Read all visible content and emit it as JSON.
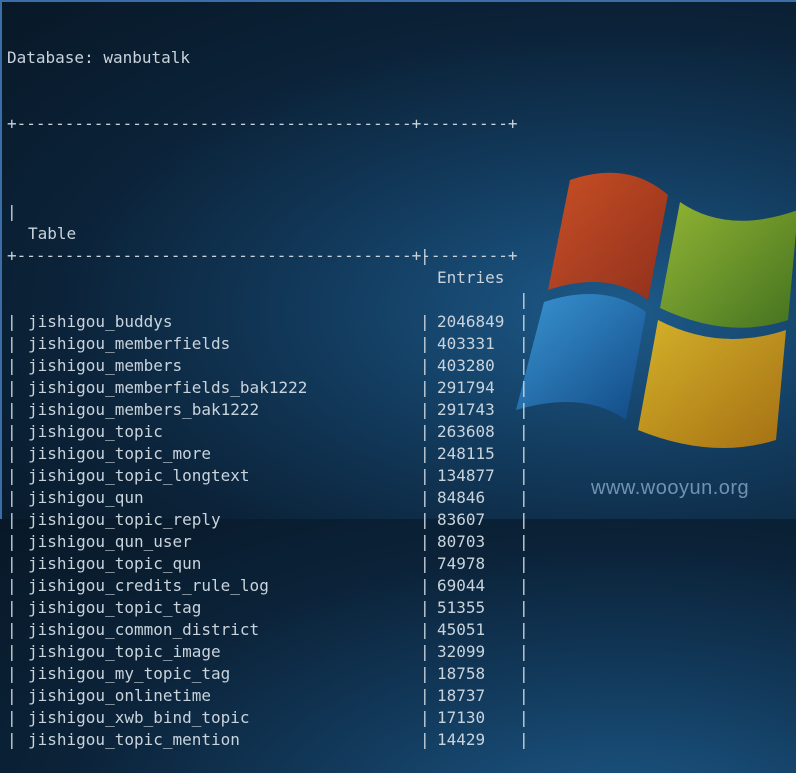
{
  "header": {
    "database_line": "Database: wanbutalk"
  },
  "table": {
    "rule": "+-----------------------------------------+---------+",
    "col_table": "Table",
    "col_entries": "Entries",
    "rows": [
      {
        "name": "jishigou_buddys",
        "entries": "2046849"
      },
      {
        "name": "jishigou_memberfields",
        "entries": "403331"
      },
      {
        "name": "jishigou_members",
        "entries": "403280"
      },
      {
        "name": "jishigou_memberfields_bak1222",
        "entries": "291794"
      },
      {
        "name": "jishigou_members_bak1222",
        "entries": "291743"
      },
      {
        "name": "jishigou_topic",
        "entries": "263608"
      },
      {
        "name": "jishigou_topic_more",
        "entries": "248115"
      },
      {
        "name": "jishigou_topic_longtext",
        "entries": "134877"
      },
      {
        "name": "jishigou_qun",
        "entries": "84846"
      },
      {
        "name": "jishigou_topic_reply",
        "entries": "83607"
      },
      {
        "name": "jishigou_qun_user",
        "entries": "80703"
      },
      {
        "name": "jishigou_topic_qun",
        "entries": "74978"
      },
      {
        "name": "jishigou_credits_rule_log",
        "entries": "69044"
      },
      {
        "name": "jishigou_topic_tag",
        "entries": "51355"
      },
      {
        "name": "jishigou_common_district",
        "entries": "45051"
      },
      {
        "name": "jishigou_topic_image",
        "entries": "32099"
      },
      {
        "name": "jishigou_my_topic_tag",
        "entries": "18758"
      },
      {
        "name": "jishigou_onlinetime",
        "entries": "18737"
      },
      {
        "name": "jishigou_xwb_bind_topic",
        "entries": "17130"
      },
      {
        "name": "jishigou_topic_mention",
        "entries": "14429"
      }
    ]
  },
  "watermark": {
    "text": "www.wooyun.org"
  }
}
